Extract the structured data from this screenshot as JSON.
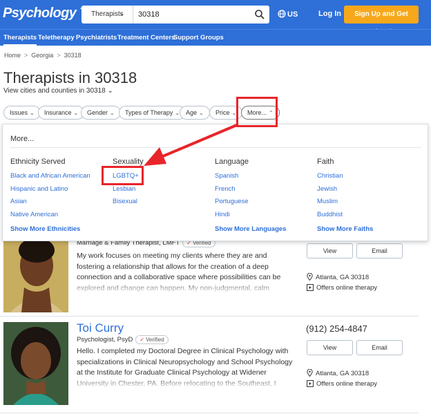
{
  "header": {
    "logo": "Psychology Today",
    "search_type": "Therapists",
    "search_value": "30318",
    "locale": "US",
    "login": "Log In",
    "signup": "Sign Up and Get Listed"
  },
  "nav": [
    "Therapists",
    "Teletherapy",
    "Psychiatrists",
    "Treatment Centers",
    "Support Groups"
  ],
  "breadcrumb": [
    "Home",
    "Georgia",
    "30318"
  ],
  "page": {
    "title": "Therapists in 30318",
    "subtitle": "View cities and counties in 30318"
  },
  "filters": [
    "Issues",
    "Insurance",
    "Gender",
    "Types of Therapy",
    "Age",
    "Price",
    "More..."
  ],
  "more_panel": {
    "title": "More...",
    "columns": [
      {
        "heading": "Ethnicity Served",
        "items": [
          "Black and African American",
          "Hispanic and Latino",
          "Asian",
          "Native American"
        ],
        "show_more": "Show More Ethnicities"
      },
      {
        "heading": "Sexuality",
        "items": [
          "LGBTQ+",
          "Lesbian",
          "Bisexual"
        ],
        "show_more": ""
      },
      {
        "heading": "Language",
        "items": [
          "Spanish",
          "French",
          "Portuguese",
          "Hindi"
        ],
        "show_more": "Show More Languages"
      },
      {
        "heading": "Faith",
        "items": [
          "Christian",
          "Jewish",
          "Muslim",
          "Buddhist"
        ],
        "show_more": "Show More Faiths"
      }
    ]
  },
  "results": [
    {
      "name": "",
      "credentials": "Marriage & Family Therapist, LMFT",
      "verified": "Verified",
      "bio": "My work focuses on meeting my clients where they are and fostering a relationship that allows for the creation of a deep connection and a collaborative space where possibilities can be explored and change can happen. My non-judgmental, calm approach allows me to work",
      "phone": "",
      "view": "View",
      "email": "Email",
      "location": "Atlanta, GA 30318",
      "online": "Offers online therapy"
    },
    {
      "name": "Toi Curry",
      "credentials": "Psychologist, PsyD",
      "verified": "Verified",
      "bio": "Hello. I completed my Doctoral Degree in Clinical Psychology with specializations in Clinical Neuropsychology and School Psychology at the Institute for Graduate Clinical Psychology at Widener University in Chester, PA. Before relocating to the Southeast, I completed a two-",
      "phone": "(912) 254-4847",
      "view": "View",
      "email": "Email",
      "location": "Atlanta, GA 30318",
      "online": "Offers online therapy"
    }
  ],
  "colors": {
    "brand_blue": "#2e6fd8",
    "signup_orange": "#f7a81a",
    "annotation_red": "#e8252b"
  }
}
